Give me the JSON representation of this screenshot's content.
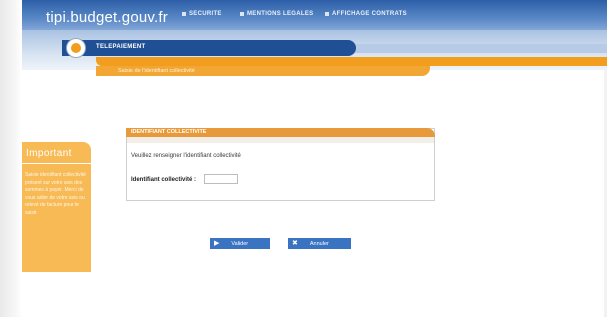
{
  "header": {
    "logo": "tipi.budget.gouv.fr",
    "nav": [
      {
        "label": "SECURITE"
      },
      {
        "label": "MENTIONS LEGALES"
      },
      {
        "label": "AFFICHAGE CONTRATS"
      }
    ]
  },
  "page": {
    "title": "TELEPAIEMENT",
    "breadcrumb": "Saisie de l'identifiant collectivité"
  },
  "sidebar": {
    "title": "Important",
    "body": "Saisie identifiant collectivité présent sur votre avis des sommes à payer. Merci de vous aider de votre avis ou relevé de facture pour le saisir."
  },
  "form": {
    "header": "IDENTIFIANT COLLECTIVITE",
    "message": "Veuillez renseigner l'identifiant collectivité",
    "field_label": "Identifiant collectivité :",
    "field_value": ""
  },
  "buttons": {
    "ok_label": "Valider",
    "cancel_label": "Annuler"
  },
  "colors": {
    "header_blue": "#2d5fa8",
    "title_blue": "#1f4f94",
    "orange": "#f29d1e",
    "sidebar_orange": "#f7ba55",
    "button_blue": "#3a73c2"
  },
  "icons": {
    "ok": "arrow-right-icon",
    "cancel": "close-icon",
    "bullet": "orange-bullet-icon"
  }
}
